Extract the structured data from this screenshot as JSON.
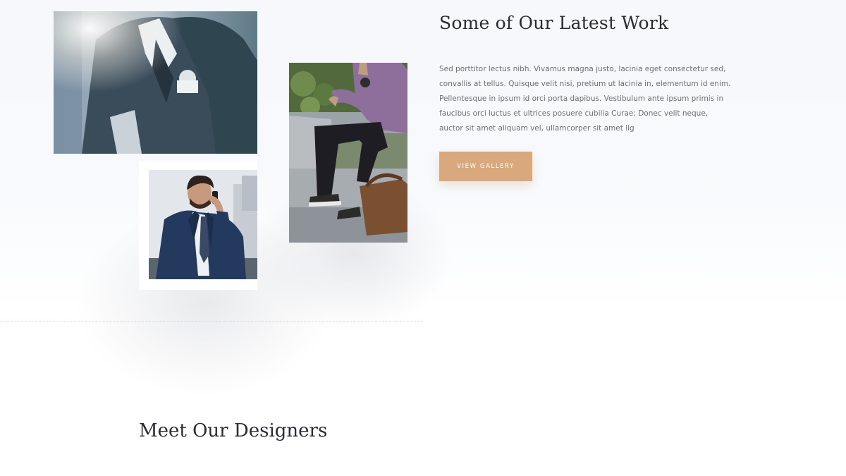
{
  "work": {
    "title": "Some of Our Latest Work",
    "paragraph_lines": [
      "Sed porttitor lectus nibh. Vivamus magna justo, lacinia eget consectetur sed,",
      "convallis at tellus. Quisque velit nisi, pretium ut lacinia in, elementum id enim.",
      "Pellentesque in ipsum id orci porta dapibus. Vestibulum ante ipsum primis in",
      "faucibus orci luctus et ultrices posuere cubilia Curae; Donec velit neque,",
      "auctor sit amet aliquam vel, ullamcorper sit amet lig"
    ],
    "button_label": "VIEW GALLERY"
  },
  "designers": {
    "title": "Meet Our Designers"
  },
  "colors": {
    "accent": "#d9a87c",
    "heading": "#2b2b33",
    "body_text": "#6b6e75",
    "background_top": "#f6f8fc"
  },
  "images": [
    {
      "name": "businessman-adjusting-jacket-photo",
      "icon": "photo-icon"
    },
    {
      "name": "businessman-on-phone-photo",
      "icon": "photo-icon"
    },
    {
      "name": "man-sitting-on-steps-photo",
      "icon": "photo-icon"
    }
  ]
}
